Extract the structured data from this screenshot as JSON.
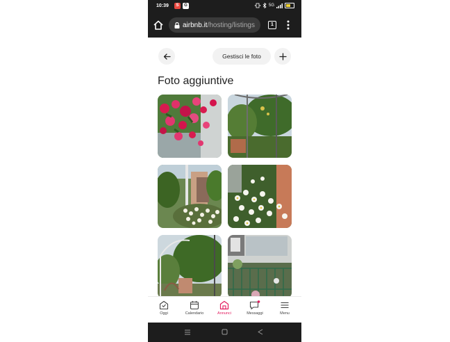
{
  "status_bar": {
    "time": "10:39",
    "app_badges": [
      "S",
      "G"
    ],
    "network_label": "5G"
  },
  "browser": {
    "url_host": "airbnb.it",
    "url_path": "/hosting/listings",
    "tab_count": "1"
  },
  "header": {
    "manage_photos_label": "Gestisci le foto"
  },
  "section": {
    "title": "Foto aggiuntive"
  },
  "photos": [
    {
      "subject": "pink roses"
    },
    {
      "subject": "garden pergola with trees"
    },
    {
      "subject": "garden stairway with white daisies"
    },
    {
      "subject": "white daisies"
    },
    {
      "subject": "garden arch with trees"
    },
    {
      "subject": "house balcony with green railing"
    }
  ],
  "bottom_nav": {
    "items": [
      {
        "label": "Oggi",
        "icon": "today-icon"
      },
      {
        "label": "Calendario",
        "icon": "calendar-icon"
      },
      {
        "label": "Annunci",
        "icon": "listings-icon"
      },
      {
        "label": "Messaggi",
        "icon": "messages-icon"
      },
      {
        "label": "Menu",
        "icon": "menu-icon"
      }
    ],
    "active_index": 2,
    "accent_color": "#e31c5f"
  }
}
